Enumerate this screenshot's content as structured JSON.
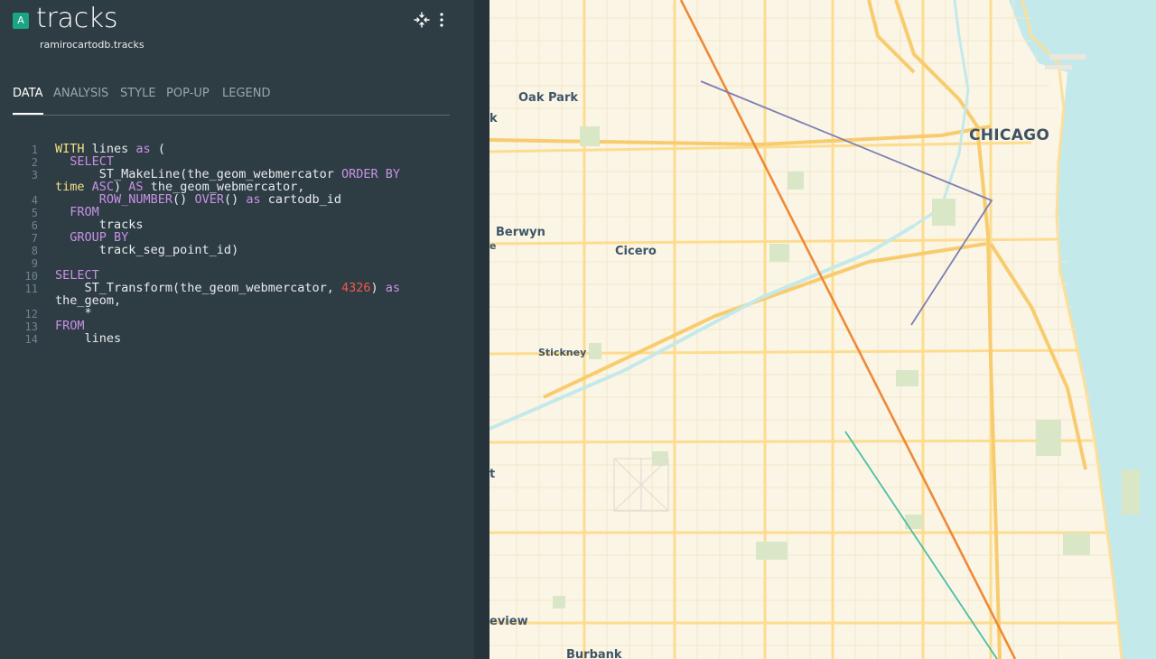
{
  "layer": {
    "badge": "A",
    "title": "tracks",
    "subtitle": "ramirocartodb.tracks"
  },
  "tabs": [
    {
      "label": "DATA",
      "active": true
    },
    {
      "label": "ANALYSIS",
      "active": false
    },
    {
      "label": "STYLE",
      "active": false
    },
    {
      "label": "POP-UP",
      "active": false
    },
    {
      "label": "LEGEND",
      "active": false
    }
  ],
  "editor": {
    "line_numbers": [
      "1",
      "2",
      "3",
      "4",
      "5",
      "6",
      "7",
      "8",
      "9",
      "10",
      "11",
      "12",
      "13",
      "14"
    ],
    "lines": [
      [
        {
          "t": "WITH",
          "c": "kw2"
        },
        {
          "t": " lines ",
          "c": ""
        },
        {
          "t": "as",
          "c": "kw"
        },
        {
          "t": " (",
          "c": ""
        }
      ],
      [
        {
          "t": "  SELECT",
          "c": "kw"
        }
      ],
      [
        {
          "t": "      ST_MakeLine(the_geom_webmercator ",
          "c": ""
        },
        {
          "t": "ORDER BY",
          "c": "kw"
        }
      ],
      [
        {
          "t": "time ",
          "c": "kw2"
        },
        {
          "t": "ASC",
          "c": "kw"
        },
        {
          "t": ") ",
          "c": ""
        },
        {
          "t": "AS",
          "c": "kw"
        },
        {
          "t": " the_geom_webmercator,",
          "c": ""
        }
      ],
      [
        {
          "t": "      ROW_NUMBER",
          "c": "kw"
        },
        {
          "t": "() ",
          "c": ""
        },
        {
          "t": "OVER",
          "c": "kw"
        },
        {
          "t": "() ",
          "c": ""
        },
        {
          "t": "as",
          "c": "kw"
        },
        {
          "t": " cartodb_id",
          "c": ""
        }
      ],
      [
        {
          "t": "  FROM",
          "c": "kw"
        }
      ],
      [
        {
          "t": "      tracks",
          "c": ""
        }
      ],
      [
        {
          "t": "  GROUP BY",
          "c": "kw"
        }
      ],
      [
        {
          "t": "      track_seg_point_id)",
          "c": ""
        }
      ],
      [
        {
          "t": "",
          "c": ""
        }
      ],
      [
        {
          "t": "SELECT",
          "c": "kw"
        }
      ],
      [
        {
          "t": "    ST_Transform(the_geom_webmercator, ",
          "c": ""
        },
        {
          "t": "4326",
          "c": "num"
        },
        {
          "t": ") ",
          "c": ""
        },
        {
          "t": "as",
          "c": "kw"
        }
      ],
      [
        {
          "t": "the_geom,",
          "c": ""
        }
      ],
      [
        {
          "t": "    *",
          "c": ""
        }
      ],
      [
        {
          "t": "FROM",
          "c": "kw"
        }
      ],
      [
        {
          "t": "    lines",
          "c": ""
        }
      ]
    ]
  },
  "map": {
    "labels": [
      {
        "name": "oak-park-label",
        "text": "Oak Park",
        "size": "normal"
      },
      {
        "name": "chicago-label",
        "text": "CHICAGO",
        "size": "city"
      },
      {
        "name": "berwyn-label",
        "text": "Berwyn",
        "size": "normal"
      },
      {
        "name": "cicero-label",
        "text": "Cicero",
        "size": "normal"
      },
      {
        "name": "stickney-label",
        "text": "Stickney",
        "size": "small"
      },
      {
        "name": "burbank-label",
        "text": "Burbank",
        "size": "normal"
      },
      {
        "name": "edge-label-k",
        "text": "k",
        "size": "normal"
      },
      {
        "name": "edge-label-e",
        "text": "e",
        "size": "small"
      },
      {
        "name": "edge-label-t",
        "text": "t",
        "size": "normal"
      },
      {
        "name": "edge-label-view",
        "text": "eview",
        "size": "normal"
      }
    ],
    "colors": {
      "water": "#c4e9eb",
      "major_road": "#fcd98a",
      "minor_road": "#f1e5c9",
      "park": "#d9e7c7",
      "track_orange": "#ee8a37",
      "track_blue": "#7a7fb4",
      "track_teal": "#4bbfa5"
    }
  }
}
